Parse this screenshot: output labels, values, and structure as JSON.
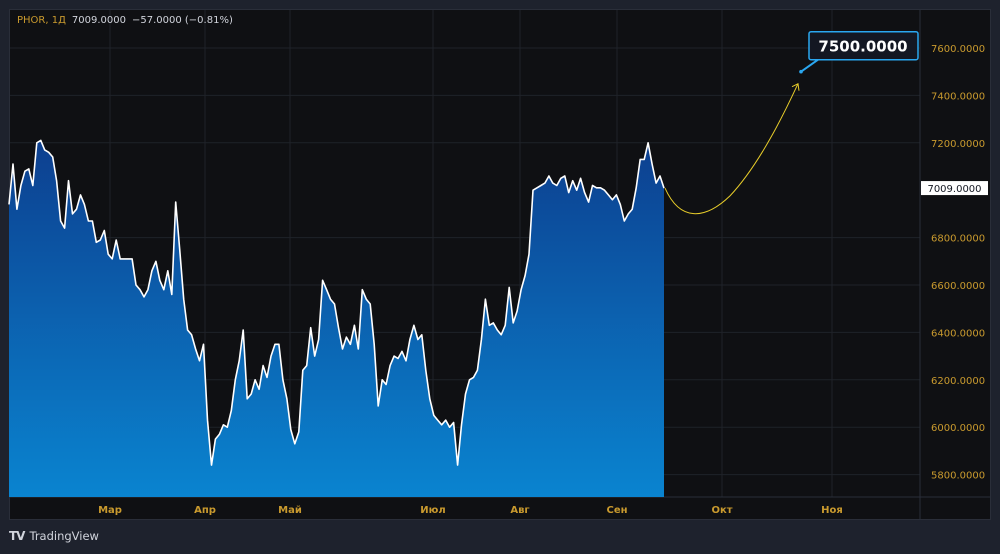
{
  "legend": {
    "symbol": "PHOR, 1Д",
    "close": "7009.0000",
    "change": "−57.0000 (−0.81%)"
  },
  "brand": {
    "logo": "TV",
    "name": "TradingView"
  },
  "chart_data": {
    "type": "area",
    "title": "PHOR, 1Д",
    "ylim": [
      5720,
      7700
    ],
    "yticks": [
      5800,
      6000,
      6200,
      6400,
      6600,
      6800,
      7200,
      7400,
      7600
    ],
    "ytick_labels": [
      "5800.0000",
      "6000.0000",
      "6200.0000",
      "6400.0000",
      "6600.0000",
      "6800.0000",
      "7200.0000",
      "7400.0000",
      "7600.0000"
    ],
    "xticks": [
      "Мар",
      "Апр",
      "Май",
      "Июл",
      "Авг",
      "Сен",
      "Окт",
      "Ноя"
    ],
    "last_price": 7009,
    "last_price_label": "7009.0000",
    "forecast": {
      "target": 7500,
      "label": "7500.0000",
      "dip": 6900
    },
    "colors": {
      "line": "#ffffff",
      "fill_top": "#0d3f8f",
      "fill_bottom": "#0a84d0",
      "axis_text": "#c99a2e",
      "forecast": "#e8cd2a",
      "callout": "#2aa7f0"
    },
    "values": [
      6940,
      7110,
      6920,
      7020,
      7080,
      7090,
      7020,
      7200,
      7210,
      7170,
      7160,
      7140,
      7040,
      6870,
      6840,
      7040,
      6900,
      6920,
      6980,
      6940,
      6870,
      6870,
      6780,
      6790,
      6830,
      6730,
      6710,
      6790,
      6710,
      6710,
      6710,
      6710,
      6600,
      6580,
      6550,
      6580,
      6660,
      6700,
      6620,
      6580,
      6660,
      6560,
      6950,
      6750,
      6540,
      6410,
      6390,
      6330,
      6280,
      6350,
      6030,
      5840,
      5950,
      5970,
      6010,
      6000,
      6070,
      6200,
      6280,
      6410,
      6120,
      6140,
      6200,
      6160,
      6260,
      6210,
      6300,
      6350,
      6350,
      6200,
      6120,
      5990,
      5930,
      5980,
      6240,
      6260,
      6420,
      6300,
      6370,
      6620,
      6580,
      6540,
      6520,
      6420,
      6330,
      6380,
      6350,
      6430,
      6330,
      6580,
      6540,
      6520,
      6350,
      6090,
      6200,
      6180,
      6260,
      6300,
      6290,
      6320,
      6280,
      6370,
      6430,
      6370,
      6390,
      6240,
      6120,
      6050,
      6030,
      6010,
      6030,
      6000,
      6020,
      5840,
      6010,
      6140,
      6200,
      6210,
      6240,
      6370,
      6540,
      6430,
      6440,
      6410,
      6390,
      6430,
      6590,
      6440,
      6490,
      6580,
      6640,
      6730,
      7000,
      7010,
      7020,
      7030,
      7060,
      7030,
      7020,
      7050,
      7060,
      6990,
      7040,
      7000,
      7050,
      6990,
      6950,
      7020,
      7010,
      7010,
      7000,
      6980,
      6960,
      6980,
      6940,
      6870,
      6900,
      6920,
      7010,
      7130,
      7130,
      7200,
      7110,
      7030,
      7060,
      7009
    ]
  }
}
